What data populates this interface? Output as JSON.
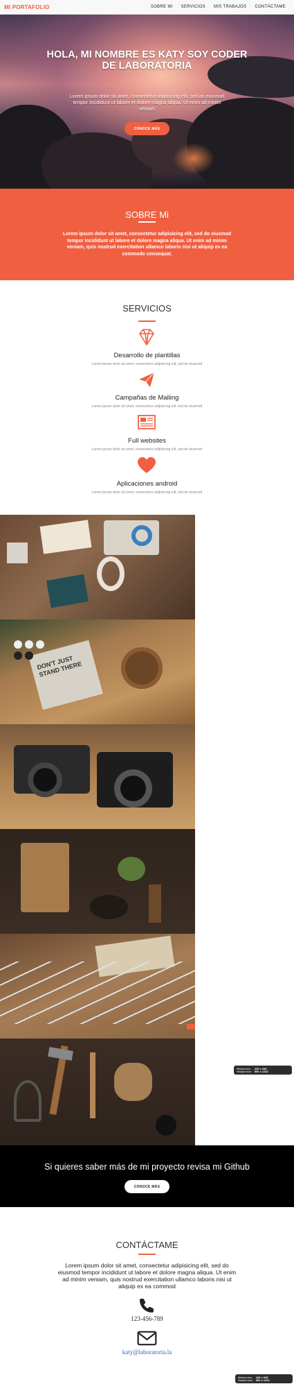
{
  "nav": {
    "brand": "MI PORTAFOLIO",
    "links": [
      "SOBRE MI",
      "SERVICIOS",
      "MIS TRABAJOS",
      "CONTÁCTAME"
    ]
  },
  "hero": {
    "title": "HOLA, MI NOMBRE ES KATY SOY CODER DE LABORATORIA",
    "text": "Lorem ipsum dolor sit amet, consectetur adipisicing elit, sed do eiusmod tempor incididunt ut labore et dolore magna aliqua. Ut enim ad minim veniam",
    "button": "CONOCE MÁS"
  },
  "about": {
    "title": "SOBRE Mi",
    "text": "Lorem ipsum dolor sit amet, consectetur adipisicing elit, sed do eiusmod tempor incididunt ut labore et dolore magna aliqua. Ut enim ad minim veniam, quis nostrud exercitation ullamco laboris nisi ut aliquip ex ea commodo consequat."
  },
  "services": {
    "title": "SERVICIOS",
    "items": [
      {
        "icon": "diamond-icon",
        "title": "Desarrollo de plantillas",
        "desc": "Lorem ipsum dolor sit amet, consectetur adipisicing elit, sed do eiusmod"
      },
      {
        "icon": "paper-plane-icon",
        "title": "Campañas de Mailing",
        "desc": "Lorem ipsum dolor sit amet, consectetur adipisicing elit, sed do eiusmod"
      },
      {
        "icon": "newspaper-icon",
        "title": "Full websites",
        "desc": "Lorem ipsum dolor sit amet, consectetur adipisicing elit, sed do eiusmod"
      },
      {
        "icon": "heart-icon",
        "title": "Aplicaciones android",
        "desc": "Lorem ipsum dolor sit amet, consectetur adipisicing elit, sed do eiusmod"
      }
    ]
  },
  "gallery": {
    "photos": [
      "tools-flatlay-photo",
      "coasters-notebook-photo",
      "vintage-cameras-photo",
      "cutting-board-photo",
      "paintbrushes-photo",
      "hand-tools-photo"
    ],
    "photo_text": "DON'T JUST STAND THERE"
  },
  "cta": {
    "title": "Si quieres saber más de mi proyecto revisa mi Github",
    "button": "CONOCE MÁS"
  },
  "contact": {
    "title": "CONTÁCTAME",
    "text": "Lorem ipsum dolor sit amet, consectetur adipisicing elit, sed do eiusmod tempor incididunt ut labore et dolore magna aliqua. Ut enim ad minim veniam, quis nostrud exercitation ullamco laboris nisi ut aliquip ex ea commod",
    "phone": "123-456-789",
    "email": "katy@laboratoria.la"
  },
  "viewport_badges": [
    {
      "label1": "Window size:",
      "value1": "425 x 636",
      "label2": "Viewport size:",
      "value2": "900 x 1232"
    },
    {
      "label1": "Window size:",
      "value1": "425 x 636",
      "label2": "Viewport size:",
      "value2": "900 x 1232"
    }
  ],
  "colors": {
    "accent": "#f05f40",
    "nav_bg": "#f8f8f8",
    "cta_bg": "#000000",
    "link": "#2a6ebb"
  }
}
